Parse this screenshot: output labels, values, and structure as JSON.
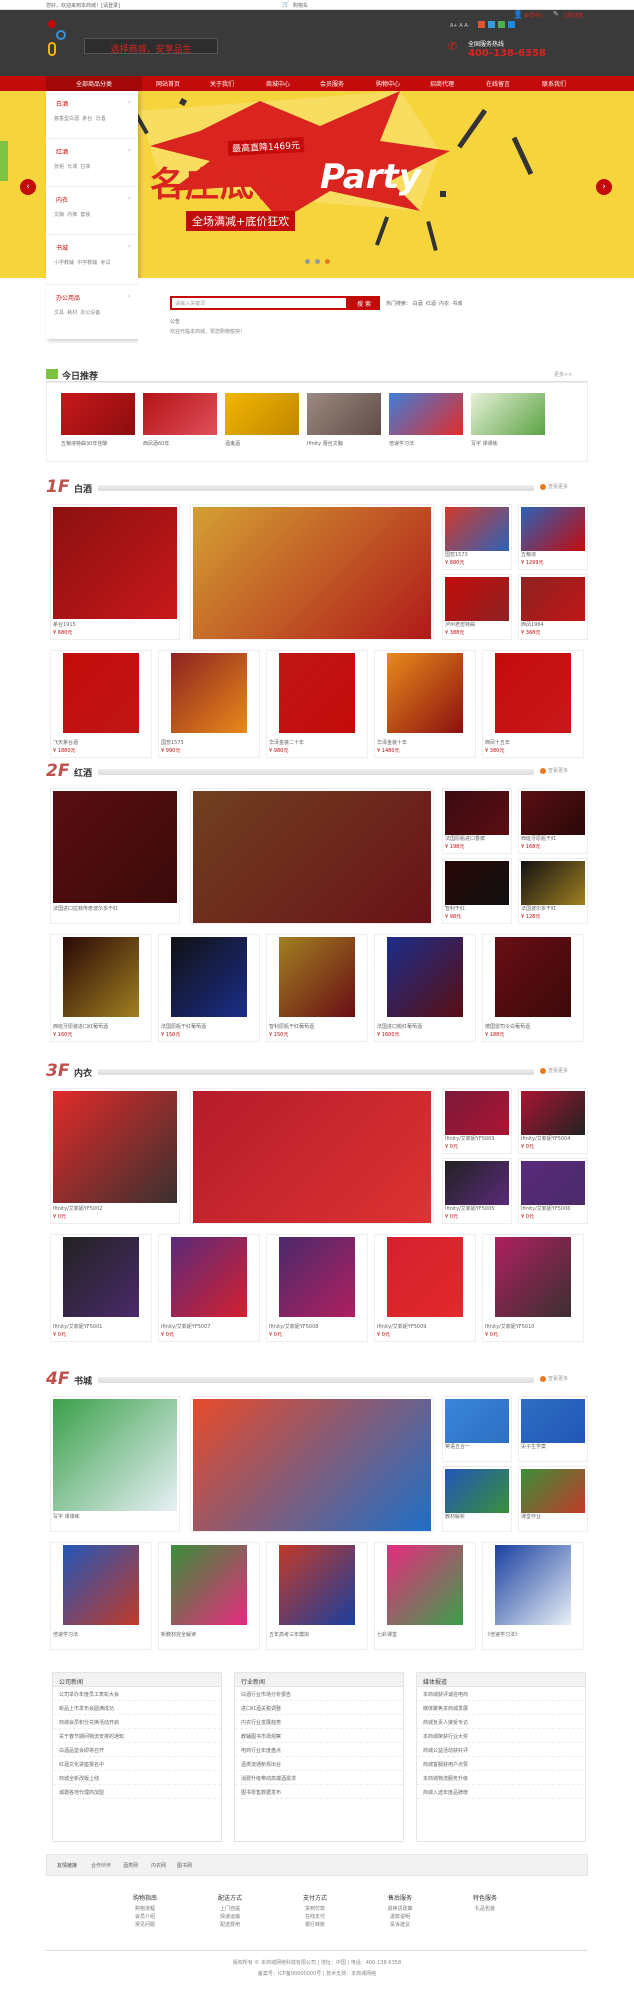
{
  "topbar": {
    "welcome": "您好，欢迎来到本商城！[请登录]",
    "cart": "购物车",
    "icons": [
      "weibo-icon",
      "qq-icon",
      "wechat-icon",
      "tqq-icon"
    ]
  },
  "header": {
    "slogan": "选择商城，安享品生",
    "user_center": "会员中心",
    "register": "立即注册",
    "hotline_label": "全国服务热线",
    "hotline": "400-138-6358",
    "colors": {
      "nav_red": "#c40b0b",
      "header_dark": "#3a3a3a",
      "accent_red": "#d9241f"
    }
  },
  "nav": {
    "category_btn": "全部商品分类",
    "items": [
      "网站首页",
      "关于我们",
      "商城中心",
      "会员服务",
      "购物中心",
      "招商代理",
      "在线留言",
      "联系我们"
    ]
  },
  "sidebar": {
    "groups": [
      {
        "title": "白酒",
        "links": [
          "酱香型白酒",
          "茅台",
          "汾酒"
        ]
      },
      {
        "title": "红酒",
        "links": [
          "张裕",
          "长城",
          "拉菲"
        ]
      },
      {
        "title": "内衣",
        "links": [
          "文胸",
          "内裤",
          "套装"
        ]
      },
      {
        "title": "书城",
        "links": [
          "小学教辅",
          "中学教辅",
          "考试"
        ]
      },
      {
        "title": "办公用品",
        "links": [
          "文具",
          "耗材",
          "办公设备"
        ]
      }
    ]
  },
  "banner": {
    "badge": "最高直降1469元",
    "headline": "名庄底价",
    "headline_en": "Party",
    "subline": "全场满减+底价狂欢"
  },
  "search": {
    "placeholder": "请输入关键词",
    "button": "搜 索",
    "hot_label": "热门搜索：",
    "hot": [
      "白酒",
      "红酒",
      "内衣",
      "书城"
    ],
    "notice_label": "公告",
    "notice": "欢迎光临本商城，祝您购物愉快！"
  },
  "today": {
    "title": "今日推荐",
    "more": "更多>>",
    "items": [
      {
        "name": "五粮液特曲30年佳酿"
      },
      {
        "name": "西凤酒60年"
      },
      {
        "name": "酒鬼酒"
      },
      {
        "name": "Ifinity 蕾丝文胸"
      },
      {
        "name": "倍速学习法"
      },
      {
        "name": "写字 课课练"
      }
    ]
  },
  "floors": [
    {
      "num": "1F",
      "title": "白酒",
      "more": "查看更多",
      "big": [
        {
          "name": "茅台1915",
          "price": "¥ 680元"
        },
        {
          "name": "",
          "price": ""
        }
      ],
      "small": [
        {
          "name": "国窖1573",
          "price": "¥ 880元"
        },
        {
          "name": "五粮液",
          "price": "¥ 1299元"
        },
        {
          "name": "泸州老窖特曲",
          "price": "¥ 388元"
        },
        {
          "name": "西凤1964",
          "price": "¥ 368元"
        }
      ],
      "row": [
        {
          "name": "飞天茅台酒",
          "price": "¥ 1880元"
        },
        {
          "name": "国窖1573",
          "price": "¥ 990元"
        },
        {
          "name": "华泽金装二十年",
          "price": "¥ 980元"
        },
        {
          "name": "华泽金装十年",
          "price": "¥ 1480元"
        },
        {
          "name": "西凤十五年",
          "price": "¥ 380元"
        }
      ]
    },
    {
      "num": "2F",
      "title": "红酒",
      "more": "查看更多",
      "big": [
        {
          "name": "法国进口拉菲传奇波尔多干红",
          "price": ""
        },
        {
          "name": "",
          "price": ""
        }
      ],
      "small": [
        {
          "name": "法国原瓶进口香槟",
          "price": "¥ 198元"
        },
        {
          "name": "西班牙原瓶干红",
          "price": "¥ 168元"
        },
        {
          "name": "智利干红",
          "price": "¥ 98元"
        },
        {
          "name": "法国波尔多干红",
          "price": "¥ 128元"
        }
      ],
      "row": [
        {
          "name": "西班牙原装进口红葡萄酒",
          "price": "¥ 160元"
        },
        {
          "name": "法国原瓶干红葡萄酒",
          "price": "¥ 150元"
        },
        {
          "name": "智利原瓶干红葡萄酒",
          "price": "¥ 150元"
        },
        {
          "name": "法国进口桃红葡萄酒",
          "price": "¥ 1600元"
        },
        {
          "name": "德国雷司令白葡萄酒",
          "price": "¥ 188元"
        }
      ]
    },
    {
      "num": "3F",
      "title": "内衣",
      "more": "查看更多",
      "big": [
        {
          "name": "Ifinity/艾菲妮YF5002",
          "price": "¥ 0元"
        },
        {
          "name": "",
          "price": ""
        }
      ],
      "small": [
        {
          "name": "Ifinity/艾菲妮YF5003",
          "price": "¥ 0元"
        },
        {
          "name": "Ifinity/艾菲妮YF5004",
          "price": "¥ 0元"
        },
        {
          "name": "Ifinity/艾菲妮YF5005",
          "price": "¥ 0元"
        },
        {
          "name": "Ifinity/艾菲妮YF5006",
          "price": "¥ 0元"
        }
      ],
      "row": [
        {
          "name": "Ifinity/艾菲妮YF5001",
          "price": "¥ 0元"
        },
        {
          "name": "Ifinity/艾菲妮YF5007",
          "price": "¥ 0元"
        },
        {
          "name": "Ifinity/艾菲妮YF5008",
          "price": "¥ 0元"
        },
        {
          "name": "Ifinity/艾菲妮YF5009",
          "price": "¥ 0元"
        },
        {
          "name": "Ifinity/艾菲妮YF5010",
          "price": "¥ 0元"
        }
      ]
    },
    {
      "num": "4F",
      "title": "书城",
      "more": "查看更多",
      "big": [
        {
          "name": "写字 课课练",
          "price": ""
        },
        {
          "name": "",
          "price": ""
        }
      ],
      "small": [
        {
          "name": "英语五合一",
          "price": ""
        },
        {
          "name": "尖子生学案",
          "price": ""
        },
        {
          "name": "教材解析",
          "price": ""
        },
        {
          "name": "课堂作业",
          "price": ""
        }
      ],
      "row": [
        {
          "name": "倍速学习法",
          "price": ""
        },
        {
          "name": "新教材完全解读",
          "price": ""
        },
        {
          "name": "五年高考三年模拟",
          "price": ""
        },
        {
          "name": "七彩课堂",
          "price": ""
        },
        {
          "name": "《倍速学习法》",
          "price": ""
        }
      ]
    }
  ],
  "news": [
    {
      "title": "公司新闻",
      "lines": [
        "公司举办年度员工表彰大会",
        "新品上市发布会圆满成功",
        "商城会员积分兑换活动开启",
        "关于春节期间物流安排的通知",
        "白酒品鉴会即将召开",
        "红酒文化讲座报名中",
        "商城全新改版上线",
        "诚邀各地代理商加盟"
      ]
    },
    {
      "title": "行业新闻",
      "lines": [
        "白酒行业市场分析报告",
        "进口红酒关税调整",
        "内衣行业发展趋势",
        "教辅图书市场观察",
        "电商行业年度盘点",
        "酒类流通新规出台",
        "消费升级带动高端酒需求",
        "图书零售数据发布"
      ]
    },
    {
      "title": "媒体报道",
      "lines": [
        "本商城获评诚信电商",
        "媒体聚焦本商城发展",
        "商城负责人接受专访",
        "本商城荣获行业大奖",
        "商城公益活动获好评",
        "商城客服获用户点赞",
        "本商城物流服务升级",
        "商城入选年度品牌榜"
      ]
    }
  ],
  "links": {
    "label": "友情链接",
    "items": [
      "合作伙伴",
      "酒类网",
      "内衣网",
      "图书网"
    ]
  },
  "services": [
    {
      "title": "购物指南",
      "links": [
        "购物流程",
        "会员介绍",
        "常见问题"
      ]
    },
    {
      "title": "配送方式",
      "links": [
        "上门自提",
        "快递运输",
        "配送费用"
      ]
    },
    {
      "title": "支付方式",
      "links": [
        "货到付款",
        "在线支付",
        "银行转账"
      ]
    },
    {
      "title": "售后服务",
      "links": [
        "退换货政策",
        "退款说明",
        "投诉建议"
      ]
    },
    {
      "title": "特色服务",
      "links": [
        "礼品包装"
      ]
    }
  ],
  "footer": {
    "line1": "版权所有 © 本商城网络科技有限公司 | 地址：中国 | 电话：400-138-6358",
    "line2": "备案号：ICP备00000000号 | 技术支持：本商城网络"
  }
}
